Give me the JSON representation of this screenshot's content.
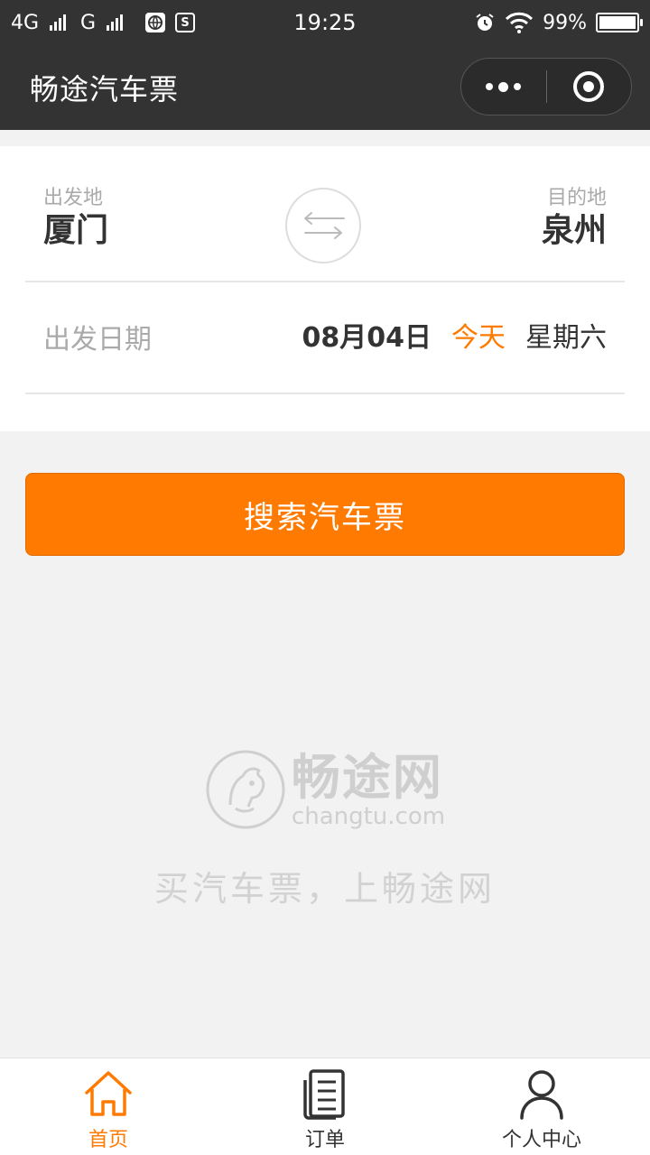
{
  "status_bar": {
    "network1": "4G",
    "network2": "G",
    "time": "19:25",
    "battery": "99%",
    "battery_level": 0.99
  },
  "nav": {
    "title": "畅途汽车票"
  },
  "route": {
    "from_label": "出发地",
    "from_city": "厦门",
    "to_label": "目的地",
    "to_city": "泉州"
  },
  "date": {
    "label": "出发日期",
    "value": "08月04日",
    "relative": "今天",
    "weekday": "星期六"
  },
  "search": {
    "button_label": "搜索汽车票"
  },
  "brand": {
    "name_cn": "畅途网",
    "domain": "changtu.com",
    "slogan": "买汽车票，上畅途网"
  },
  "tabs": [
    {
      "label": "首页",
      "icon": "home-icon",
      "active": true
    },
    {
      "label": "订单",
      "icon": "order-list-icon",
      "active": false
    },
    {
      "label": "个人中心",
      "icon": "user-icon",
      "active": false
    }
  ],
  "colors": {
    "accent": "#ff7a00",
    "header": "#333333",
    "background": "#f2f2f2"
  }
}
